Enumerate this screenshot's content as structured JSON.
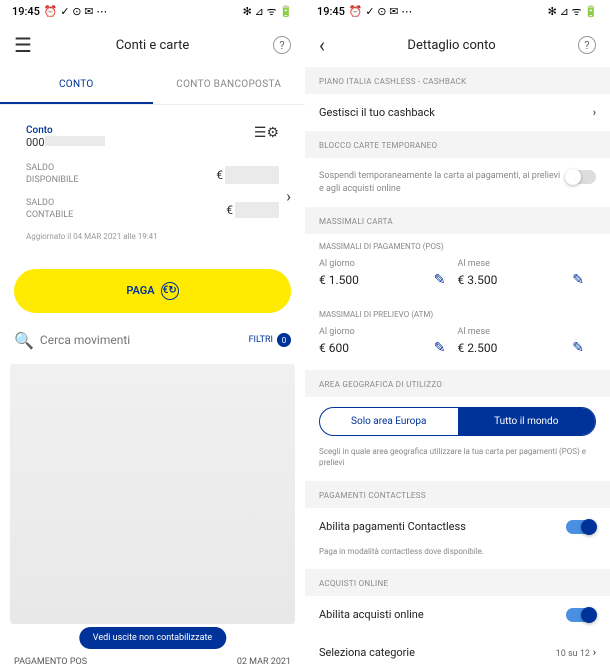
{
  "status": {
    "time": "19:45",
    "left_icons": "⏰ ✓ ⊙ ✉ ⋯",
    "right_icons": "✻ ⊿ ᯤ 🔋"
  },
  "left": {
    "title": "Conti e carte",
    "tabs": {
      "conto": "CONTO",
      "bancoposta": "CONTO BANCOPOSTA"
    },
    "card": {
      "conto_label": "Conto",
      "conto_prefix": "000",
      "saldo_disp_lbl": "SALDO\nDISPONIBILE",
      "saldo_cont_lbl": "SALDO\nCONTABILE",
      "euro": "€",
      "updated": "Aggiornato il 04 MAR 2021 alle 19:41"
    },
    "paga_label": "PAGA",
    "search_placeholder": "Cerca movimenti",
    "filtri_label": "FILTRI",
    "filtri_count": "0",
    "pill": "Vedi uscite non contabilizzate",
    "bottom": {
      "left": "PAGAMENTO POS",
      "right": "02 MAR 2021"
    }
  },
  "right": {
    "title": "Dettaglio conto",
    "sections": {
      "cashback_hdr": "PIANO ITALIA CASHLESS - CASHBACK",
      "cashback_row": "Gestisci il tuo cashback",
      "blocco_hdr": "BLOCCO CARTE TEMPORANEO",
      "blocco_desc": "Sospendi temporaneamente la carta ai pagamenti, ai prelievi e agli acquisti online",
      "massimali_hdr": "MASSIMALI CARTA",
      "pos_sub": "MASSIMALI DI PAGAMENTO (POS)",
      "atm_sub": "MASSIMALI DI PRELIEVO (ATM)",
      "day_lbl": "Al giorno",
      "month_lbl": "Al mese",
      "pos_day": "€ 1.500",
      "pos_month": "€ 3.500",
      "atm_day": "€ 600",
      "atm_month": "€ 2.500",
      "geo_hdr": "AREA GEOGRAFICA DI UTILIZZO",
      "geo_eu": "Solo area Europa",
      "geo_world": "Tutto il mondo",
      "geo_note": "Scegli in quale area geografica utilizzare la tua carta per pagamenti (POS) e prelievi",
      "contactless_hdr": "PAGAMENTI CONTACTLESS",
      "contactless_row": "Abilita pagamenti Contactless",
      "contactless_note": "Paga in modalità contactless dove disponibile.",
      "online_hdr": "ACQUISTI ONLINE",
      "online_row": "Abilita acquisti online",
      "cat_row": "Seleziona categorie",
      "cat_count": "10 su 12"
    }
  }
}
